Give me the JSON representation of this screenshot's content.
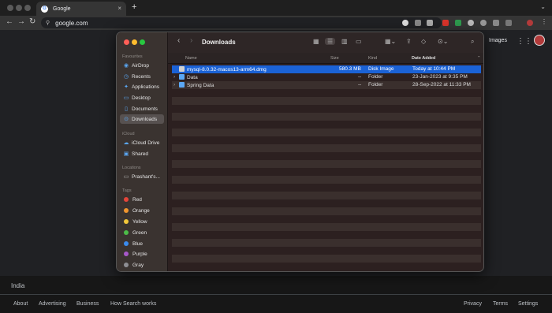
{
  "browser": {
    "tab_title": "Google",
    "tab_close": "×",
    "new_tab": "+",
    "tab_menu": "⌄",
    "url": "google.com",
    "nav": {
      "back": "←",
      "forward": "→",
      "reload": "↻",
      "home": "⌂"
    }
  },
  "google": {
    "images_link": "Images",
    "country": "India",
    "footer_left": [
      "About",
      "Advertising",
      "Business",
      "How Search works"
    ],
    "footer_right": [
      "Privacy",
      "Terms",
      "Settings"
    ]
  },
  "finder": {
    "title": "Downloads",
    "sidebar": {
      "favourites_header": "Favourites",
      "favourites": [
        {
          "label": "AirDrop",
          "icon": "◉"
        },
        {
          "label": "Recents",
          "icon": "◷"
        },
        {
          "label": "Applications",
          "icon": "✦"
        },
        {
          "label": "Desktop",
          "icon": "▭"
        },
        {
          "label": "Documents",
          "icon": "▯"
        },
        {
          "label": "Downloads",
          "icon": "⊙"
        }
      ],
      "icloud_header": "iCloud",
      "icloud": [
        {
          "label": "iCloud Drive",
          "icon": "☁"
        },
        {
          "label": "Shared",
          "icon": "▣"
        }
      ],
      "locations_header": "Locations",
      "locations": [
        {
          "label": "Prashant's...",
          "icon": "▭"
        }
      ],
      "tags_header": "Tags",
      "tags": [
        {
          "label": "Red",
          "color": "#e5453a"
        },
        {
          "label": "Orange",
          "color": "#f0952e"
        },
        {
          "label": "Yellow",
          "color": "#f3c73a"
        },
        {
          "label": "Green",
          "color": "#4cbc48"
        },
        {
          "label": "Blue",
          "color": "#3a8cef"
        },
        {
          "label": "Purple",
          "color": "#a758c9"
        },
        {
          "label": "Gray",
          "color": "#8e8e93"
        }
      ]
    },
    "columns": {
      "name": "Name",
      "size": "Size",
      "kind": "Kind",
      "date": "Date Added"
    },
    "files": [
      {
        "name": "mysql-8.0.32-macos13-arm64.dmg",
        "size": "580.3 MB",
        "kind": "Disk Image",
        "date": "Today at 10:44 PM",
        "type": "dmg",
        "selected": true
      },
      {
        "name": "Data",
        "size": "--",
        "kind": "Folder",
        "date": "23-Jan-2023 at 9:35 PM",
        "type": "folder",
        "selected": false
      },
      {
        "name": "Spring Data",
        "size": "--",
        "kind": "Folder",
        "date": "28-Sep-2022 at 11:33 PM",
        "type": "folder",
        "selected": false
      }
    ],
    "colors": {
      "selection": "#1b62d6",
      "folder": "#5ba8f5"
    }
  }
}
